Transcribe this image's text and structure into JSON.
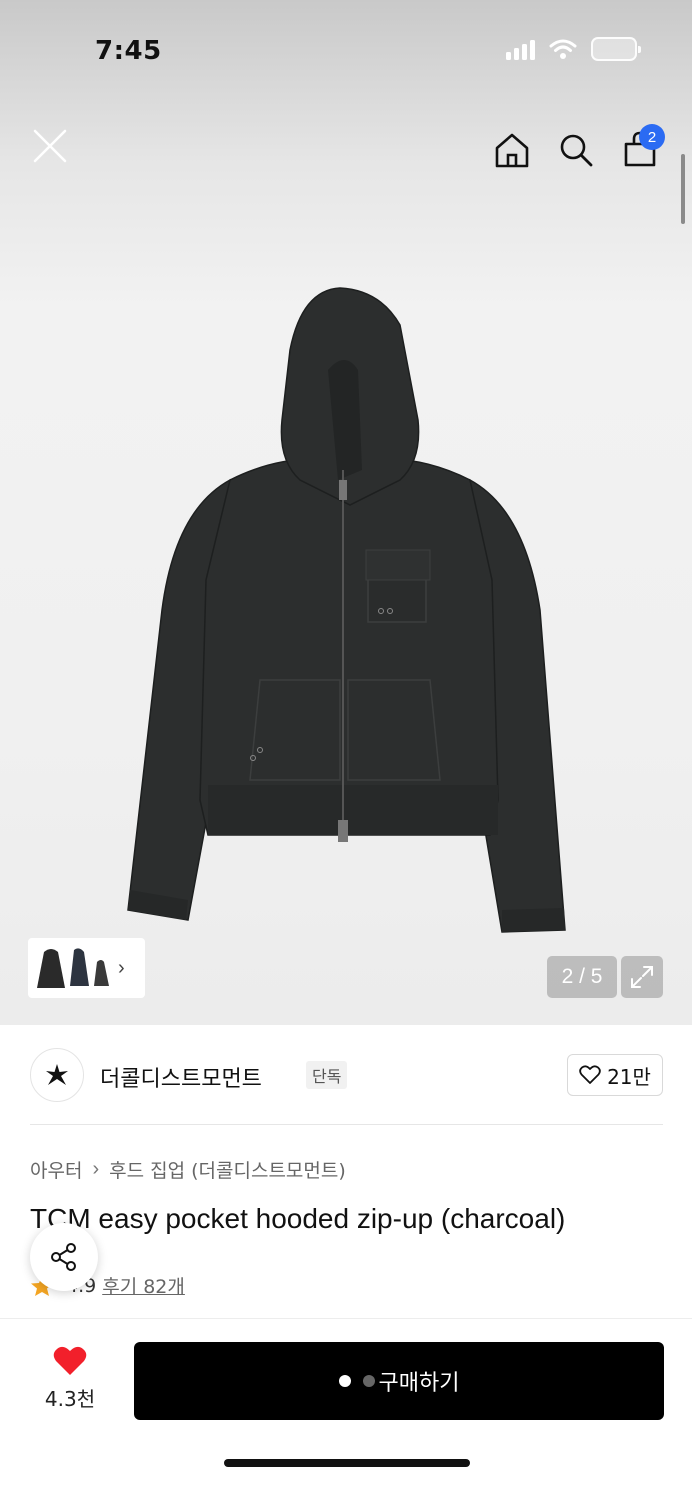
{
  "status_bar": {
    "time": "7:45"
  },
  "header": {
    "close_icon": "close-icon",
    "home_icon": "home-icon",
    "search_icon": "search-icon",
    "cart_icon": "shopping-bag-icon",
    "cart_badge": "2",
    "accent_color": "#2b6bf3"
  },
  "gallery": {
    "counter": "2 / 5",
    "current_image": 2,
    "total_images": 5,
    "thumbnail_chevron": "›",
    "expand_icon": "expand-icon"
  },
  "brand": {
    "name": "더콜디스트모먼트",
    "tag": "단독",
    "like_count": "21만",
    "logo_icon": "star-logo"
  },
  "product": {
    "breadcrumb": [
      "아우터",
      "후드 집업 (더콜디스트모먼트)"
    ],
    "breadcrumb_separator": "›",
    "title": "TCM easy pocket hooded zip-up (charcoal)",
    "rating": "4.9",
    "reviews_label": "후기 82개"
  },
  "bottom_bar": {
    "wish_count": "4.3천",
    "buy_label": "구매하기",
    "wish_color": "#f2202b"
  }
}
